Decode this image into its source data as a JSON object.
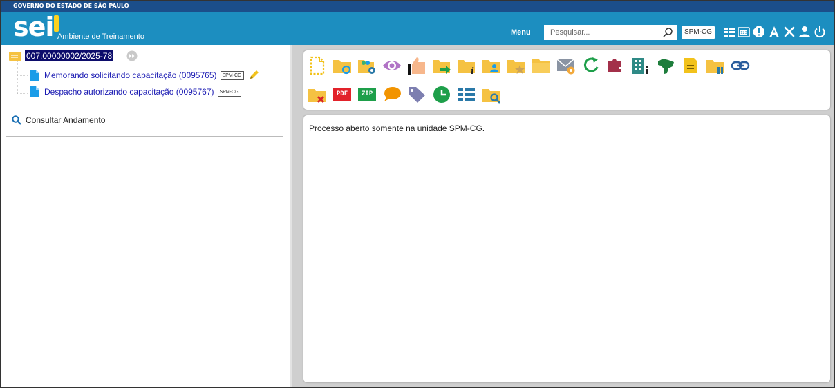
{
  "gov_bar": {
    "text": "GOVERNO DO ESTADO DE SÃO PAULO"
  },
  "header": {
    "logo_text": "sei",
    "environment": "Ambiente de Treinamento",
    "menu_label": "Menu",
    "search_placeholder": "Pesquisar...",
    "unit": "SPM-CG",
    "icons": [
      "list-icon",
      "calendar-123-icon",
      "alert-icon",
      "font-a-icon",
      "tools-icon",
      "user-icon",
      "power-icon"
    ]
  },
  "tree": {
    "process_number": "007.00000002/2025-78",
    "documents": [
      {
        "label": "Memorando solicitando capacitação (0095765)",
        "unit": "SPM-CG",
        "signed": true
      },
      {
        "label": "Despacho autorizando capacitação (0095767)",
        "unit": "SPM-CG",
        "signed": false
      }
    ],
    "consult_label": "Consultar Andamento"
  },
  "toolbar": {
    "icons": [
      "new-document-icon",
      "folder-sync-icon",
      "folder-users-gear-icon",
      "eye-icon",
      "thumbs-up-icon",
      "folder-send-icon",
      "folder-info-icon",
      "folder-user-icon",
      "folder-star-icon",
      "folder-icon",
      "envelope-at-icon",
      "refresh-icon",
      "puzzle-add-icon",
      "building-info-icon",
      "brazil-map-icon",
      "note-icon",
      "folder-pause-icon",
      "link-icon",
      "folder-close-icon",
      "pdf-icon",
      "zip-icon",
      "comment-icon",
      "tag-icon",
      "clock-icon",
      "list-icon",
      "folder-search-icon"
    ],
    "pdf_text": "PDF",
    "zip_text": "ZIP"
  },
  "content": {
    "message": "Processo aberto somente na unidade SPM-CG."
  },
  "colors": {
    "header": "#1c8ec0",
    "gov_bar": "#1b4e8a",
    "folder": "#f5c242",
    "green": "#1e9f4a",
    "link": "#1b1bb3"
  }
}
